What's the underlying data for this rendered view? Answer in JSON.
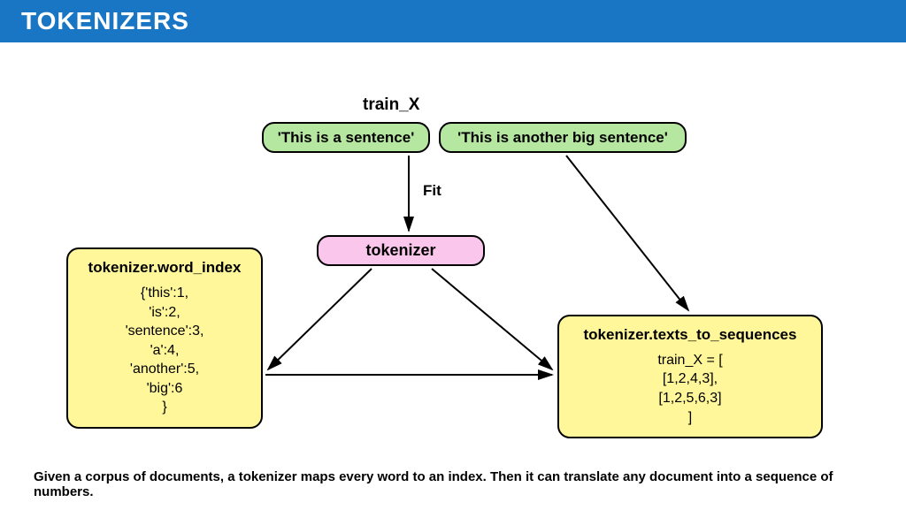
{
  "header": {
    "title": "TOKENIZERS"
  },
  "diagram": {
    "train_label": "train_X",
    "sentence1": "'This is a sentence'",
    "sentence2": "'This is another big sentence'",
    "fit_label": "Fit",
    "tokenizer_label": "tokenizer",
    "word_index": {
      "title": "tokenizer.word_index",
      "body": "{'this':1,\n'is':2,\n'sentence':3,\n'a':4,\n'another':5,\n'big':6\n}"
    },
    "texts_to_sequences": {
      "title": "tokenizer.texts_to_sequences",
      "body": "train_X = [\n[1,2,4,3],\n[1,2,5,6,3]\n]"
    }
  },
  "footer": "Given a corpus of documents, a tokenizer maps every word to an index. Then it can translate any document into a sequence of numbers."
}
